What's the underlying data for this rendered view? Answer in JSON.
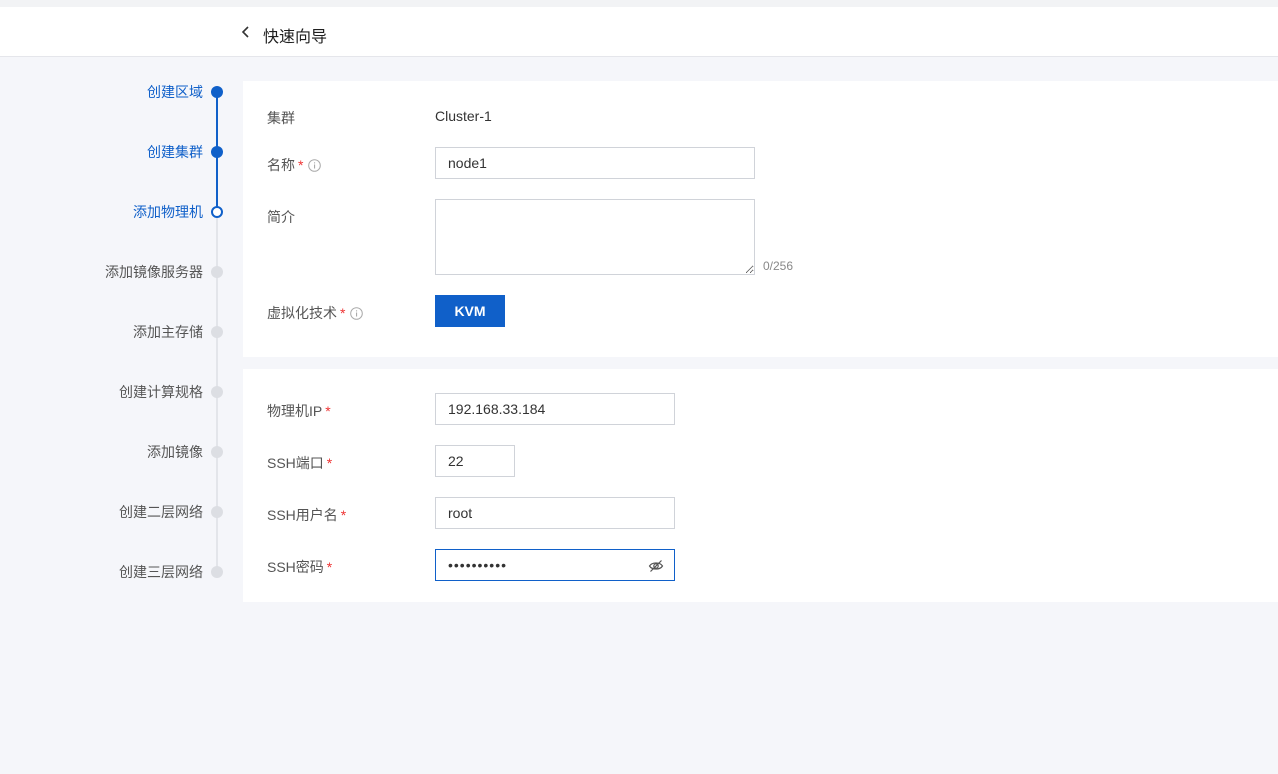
{
  "header": {
    "title": "快速向导"
  },
  "steps": [
    {
      "label": "创建区域",
      "state": "done"
    },
    {
      "label": "创建集群",
      "state": "done"
    },
    {
      "label": "添加物理机",
      "state": "current"
    },
    {
      "label": "添加镜像服务器",
      "state": "todo"
    },
    {
      "label": "添加主存储",
      "state": "todo"
    },
    {
      "label": "创建计算规格",
      "state": "todo"
    },
    {
      "label": "添加镜像",
      "state": "todo"
    },
    {
      "label": "创建二层网络",
      "state": "todo"
    },
    {
      "label": "创建三层网络",
      "state": "todo"
    }
  ],
  "form1": {
    "cluster_label": "集群",
    "cluster_value": "Cluster-1",
    "name_label": "名称",
    "name_value": "node1",
    "desc_label": "简介",
    "desc_value": "",
    "desc_counter": "0/256",
    "virt_label": "虚拟化技术",
    "virt_button": "KVM"
  },
  "form2": {
    "ip_label": "物理机IP",
    "ip_value": "192.168.33.184",
    "port_label": "SSH端口",
    "port_value": "22",
    "user_label": "SSH用户名",
    "user_value": "root",
    "pw_label": "SSH密码",
    "pw_masked": "••••••••••"
  },
  "required_mark": "*",
  "colors": {
    "accent": "#1060c9",
    "required": "#e33333",
    "inactive_dot": "#dcdee3"
  }
}
